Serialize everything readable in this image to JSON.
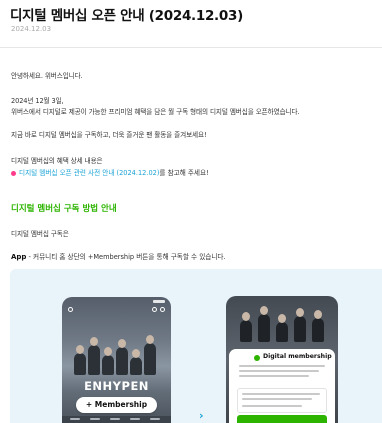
{
  "notice": {
    "title": "디지털 멤버십 오픈 안내 (2024.12.03)",
    "date": "2024.12.03"
  },
  "body": {
    "greeting": "안녕하세요. 위버스입니다.",
    "line1": "2024년 12월 3일,",
    "line2": "위버스에서 디지털로 제공이 가능한 프리미엄 혜택을 담은 월 구독 형태의 디지털 멤버십을 오픈하였습니다.",
    "line3": "지금 바로 디지털 멤버십을 구독하고, 더욱 즐거운 팬 활동을 즐겨보세요!",
    "line4": "디지털 멤버십의 혜택 상세 내용은",
    "link_text": "디지털 멤버십 오픈 관련 사전 안내 (2024.12.02)",
    "link_tail": "를 참고해 주세요!",
    "section_heading": "디지털 멤버십 구독 방법 안내",
    "section_sub": "디지털 멤버십 구독은",
    "app_label": "App",
    "app_text": " - 커뮤니티 홈 상단의 +Membership 버튼을 통해 구독할 수 있습니다."
  },
  "figure": {
    "artist_name": "ENHYPEN",
    "membership_button": "+ Membership",
    "sheet_title": "Digital membership",
    "next_arrow": "›"
  },
  "colors": {
    "accent_green": "#2db400",
    "link_blue": "#1aa3d6",
    "bullet_pink": "#ff3b8a",
    "panel_bg": "#e9f3fa"
  }
}
